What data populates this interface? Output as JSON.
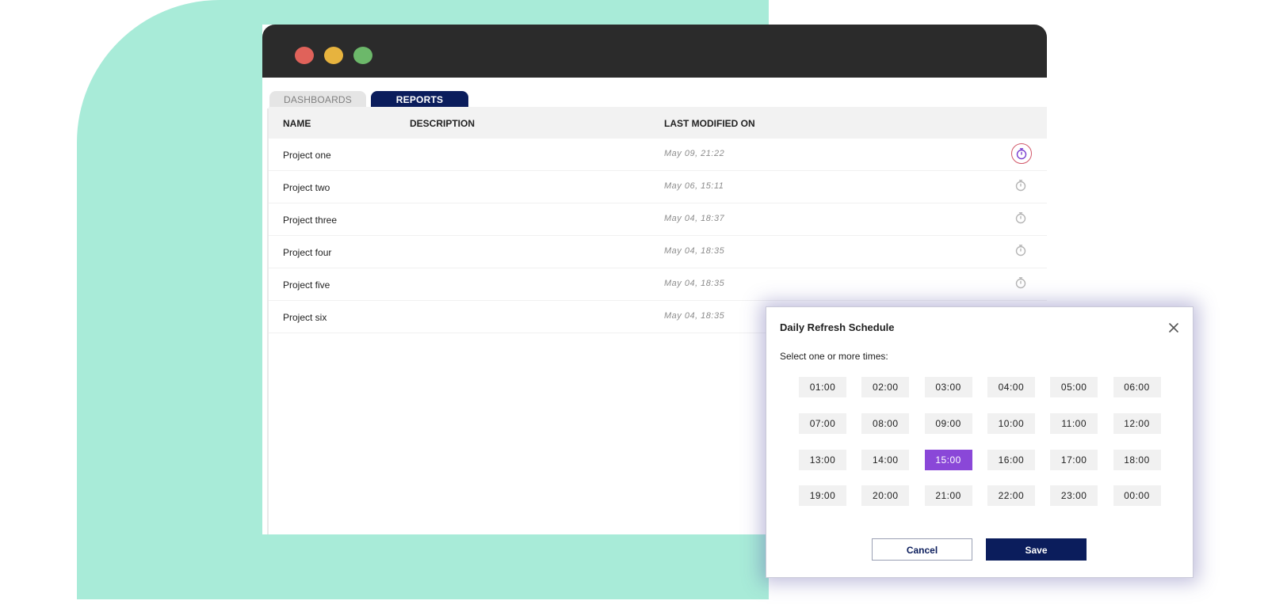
{
  "tabs": {
    "dashboards": "DASHBOARDS",
    "reports": "REPORTS",
    "active": "REPORTS"
  },
  "table": {
    "headers": {
      "name": "NAME",
      "description": "DESCRIPTION",
      "modified": "LAST MODIFIED ON"
    },
    "rows": [
      {
        "name": "Project one",
        "date": "May 09, 21:22",
        "icon": "stopwatch-icon",
        "active": true
      },
      {
        "name": "Project two",
        "date": "May 06, 15:11",
        "icon": "stopwatch-icon",
        "active": false
      },
      {
        "name": "Project three",
        "date": "May 04, 18:37",
        "icon": "stopwatch-icon",
        "active": false
      },
      {
        "name": "Project four",
        "date": "May 04, 18:35",
        "icon": "stopwatch-icon",
        "active": false
      },
      {
        "name": "Project five",
        "date": "May 04, 18:35",
        "icon": "stopwatch-icon",
        "active": false
      },
      {
        "name": "Project six",
        "date": "May 04, 18:35",
        "icon": "stopwatch-icon",
        "active": false
      }
    ]
  },
  "modal": {
    "title": "Daily Refresh Schedule",
    "subtitle": "Select one or more times:",
    "close_icon": "close-icon",
    "times": [
      "01:00",
      "02:00",
      "03:00",
      "04:00",
      "05:00",
      "06:00",
      "07:00",
      "08:00",
      "09:00",
      "10:00",
      "11:00",
      "12:00",
      "13:00",
      "14:00",
      "15:00",
      "16:00",
      "17:00",
      "18:00",
      "19:00",
      "20:00",
      "21:00",
      "22:00",
      "23:00",
      "00:00"
    ],
    "selected": [
      "15:00"
    ],
    "cancel_label": "Cancel",
    "save_label": "Save"
  },
  "colors": {
    "background_shape": "#a8ebd8",
    "titlebar": "#2b2b2b",
    "navy": "#0b1d5c",
    "selected_purple": "#8a47d8",
    "window_close": "#e0625a",
    "window_minimize": "#e7b33e",
    "window_maximize": "#6cb86a"
  }
}
